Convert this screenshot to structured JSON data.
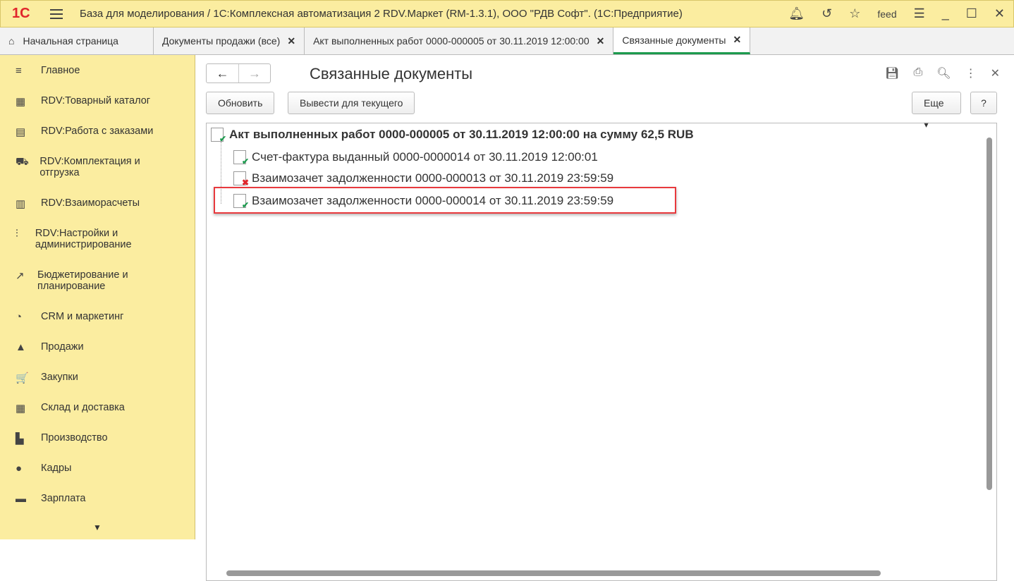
{
  "titlebar": {
    "logo": "1С",
    "title": "База для моделирования / 1С:Комплексная автоматизация 2 RDV.Маркет (RM-1.3.1), ООО \"РДВ Софт\".  (1С:Предприятие)",
    "user": "feed"
  },
  "tabs": [
    {
      "label": "Начальная страница"
    },
    {
      "label": "Документы продажи (все)"
    },
    {
      "label": "Акт выполненных работ 0000-000005 от 30.11.2019 12:00:00"
    },
    {
      "label": "Связанные документы"
    }
  ],
  "sidebar": [
    {
      "label": "Главное",
      "icon": "≡"
    },
    {
      "label": "RDV:Товарный каталог",
      "icon": "▦"
    },
    {
      "label": "RDV:Работа с заказами",
      "icon": "▤"
    },
    {
      "label": "RDV:Комплектация и отгрузка",
      "icon": "⛟"
    },
    {
      "label": "RDV:Взаиморасчеты",
      "icon": "▥"
    },
    {
      "label": "RDV:Настройки и администрирование",
      "icon": "⫶"
    },
    {
      "label": "Бюджетирование и планирование",
      "icon": "↗"
    },
    {
      "label": "CRM и маркетинг",
      "icon": "◔"
    },
    {
      "label": "Продажи",
      "icon": "▲"
    },
    {
      "label": "Закупки",
      "icon": "🛒"
    },
    {
      "label": "Склад и доставка",
      "icon": "▦"
    },
    {
      "label": "Производство",
      "icon": "▙"
    },
    {
      "label": "Кадры",
      "icon": "●"
    },
    {
      "label": "Зарплата",
      "icon": "▬"
    }
  ],
  "main": {
    "title": "Связанные документы",
    "refresh": "Обновить",
    "show_current": "Вывести для текущего",
    "more": "Еще",
    "help": "?",
    "tree": [
      {
        "label": "Акт выполненных работ 0000-000005 от 30.11.2019 12:00:00 на сумму 62,5 RUB",
        "status": "posted"
      },
      {
        "label": "Счет-фактура выданный 0000-0000014 от 30.11.2019 12:00:01",
        "status": "posted"
      },
      {
        "label": "Взаимозачет задолженности 0000-000013 от 30.11.2019 23:59:59",
        "status": "deleted"
      },
      {
        "label": "Взаимозачет задолженности 0000-000014 от 30.11.2019 23:59:59",
        "status": "posted"
      }
    ]
  }
}
